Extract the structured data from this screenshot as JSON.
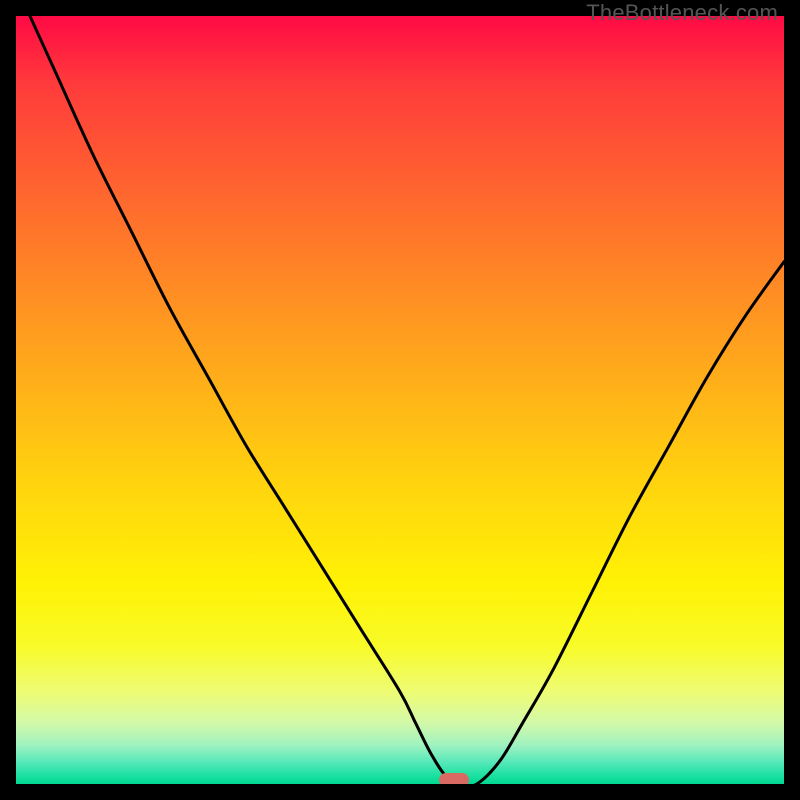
{
  "watermark": "TheBottleneck.com",
  "marker_color": "#d86a63",
  "chart_data": {
    "type": "line",
    "title": "",
    "xlabel": "",
    "ylabel": "",
    "xlim": [
      0,
      100
    ],
    "ylim": [
      0,
      100
    ],
    "series": [
      {
        "name": "bottleneck-curve",
        "x": [
          0,
          5,
          10,
          15,
          20,
          25,
          30,
          35,
          40,
          45,
          50,
          52,
          54,
          56,
          58,
          60,
          63,
          66,
          70,
          75,
          80,
          85,
          90,
          95,
          100
        ],
        "y": [
          104,
          93,
          82,
          72,
          62,
          53,
          44,
          36,
          28,
          20,
          12,
          8,
          4,
          1,
          0,
          0,
          3,
          8,
          15,
          25,
          35,
          44,
          53,
          61,
          68
        ]
      }
    ],
    "marker": {
      "x": 57,
      "y": 0
    },
    "gradient_stops": [
      {
        "pct": 0,
        "color": "#ff0a45"
      },
      {
        "pct": 9,
        "color": "#ff3b3b"
      },
      {
        "pct": 22,
        "color": "#ff6330"
      },
      {
        "pct": 35,
        "color": "#ff8a24"
      },
      {
        "pct": 48,
        "color": "#ffb019"
      },
      {
        "pct": 61,
        "color": "#ffd40e"
      },
      {
        "pct": 74,
        "color": "#fff205"
      },
      {
        "pct": 82,
        "color": "#f8fb28"
      },
      {
        "pct": 88,
        "color": "#eefc74"
      },
      {
        "pct": 92,
        "color": "#d3f9a8"
      },
      {
        "pct": 95,
        "color": "#9ef2c0"
      },
      {
        "pct": 97,
        "color": "#5ce9ba"
      },
      {
        "pct": 99,
        "color": "#18e0a0"
      },
      {
        "pct": 100,
        "color": "#00d890"
      }
    ]
  }
}
